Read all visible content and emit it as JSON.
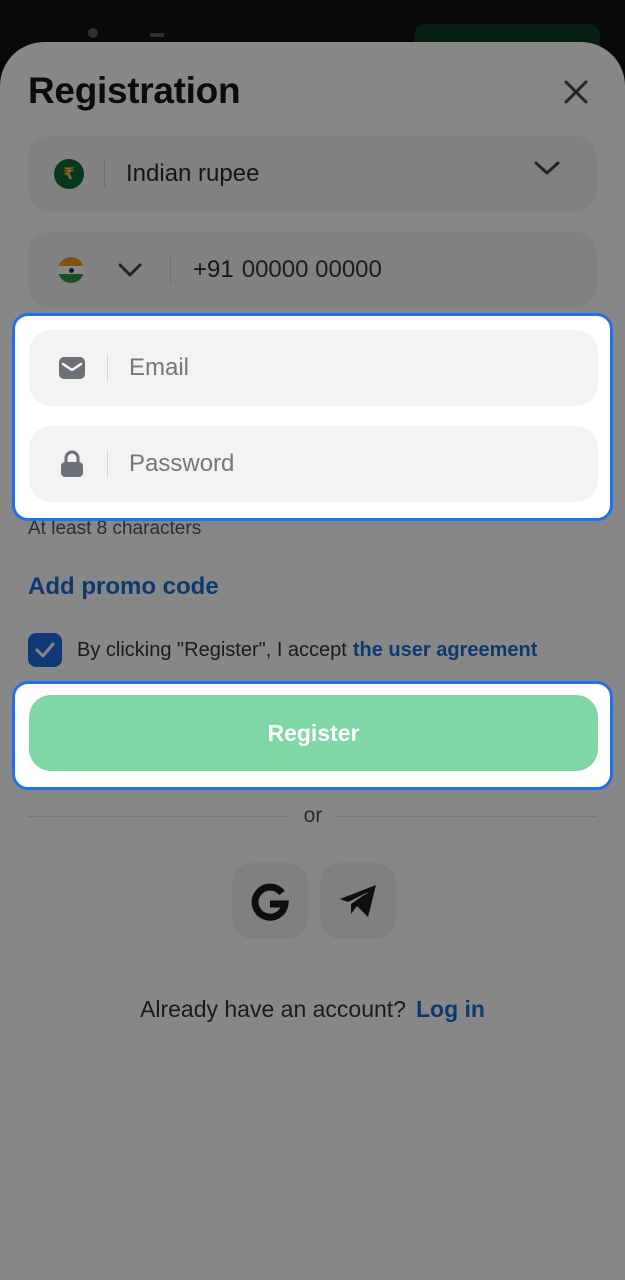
{
  "sheet": {
    "title": "Registration",
    "close_icon": "close-icon"
  },
  "currency": {
    "symbol": "₹",
    "label": "Indian rupee",
    "icon": "rupee-coin-icon"
  },
  "phone": {
    "country_flag": "india-flag-icon",
    "code": "+91",
    "placeholder": "00000 00000"
  },
  "email": {
    "icon": "mail-icon",
    "placeholder": "Email"
  },
  "password": {
    "icon": "lock-icon",
    "placeholder": "Password",
    "hint": "At least 8 characters"
  },
  "promo": {
    "label": "Add promo code"
  },
  "agreement": {
    "checked": true,
    "text": "By clicking \"Register\", I accept",
    "link": "the user agreement"
  },
  "register": {
    "label": "Register"
  },
  "divider": {
    "label": "or"
  },
  "social": {
    "google_icon": "google-icon",
    "telegram_icon": "telegram-icon"
  },
  "login": {
    "question": "Already have an account?",
    "link": "Log in"
  },
  "colors": {
    "accent_blue": "#1a6fd0",
    "register_green": "#7fd7a6",
    "highlight_border": "#1f73e8"
  }
}
